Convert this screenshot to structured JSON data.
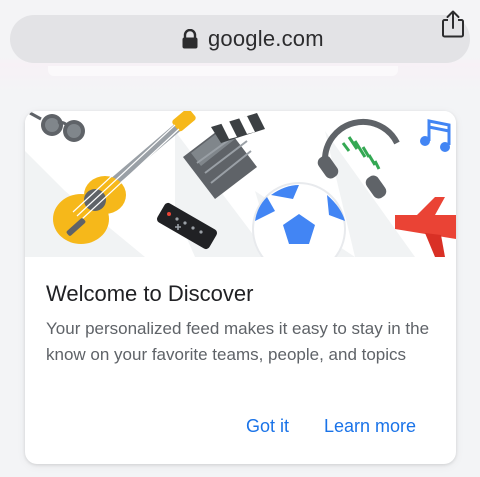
{
  "browser": {
    "url": "google.com",
    "lock_icon": "lock-icon",
    "share_icon": "share-icon"
  },
  "card": {
    "title": "Welcome to Discover",
    "body": "Your personalized feed makes it easy to stay in the know on your favorite teams, people, and topics",
    "illustration_icons": [
      "sunglasses-icon",
      "guitar-icon",
      "clapperboard-icon",
      "tv-remote-icon",
      "headphones-icon",
      "soccer-ball-icon",
      "music-notes-icon",
      "airplane-icon"
    ],
    "buttons": {
      "got_it": "Got it",
      "learn_more": "Learn more"
    }
  },
  "colors": {
    "accent": "#1a73e8",
    "guitar": "#f6b81a",
    "ball": "#4285f4",
    "headphones_eq": "#34a853",
    "airplane": "#ea4335"
  }
}
